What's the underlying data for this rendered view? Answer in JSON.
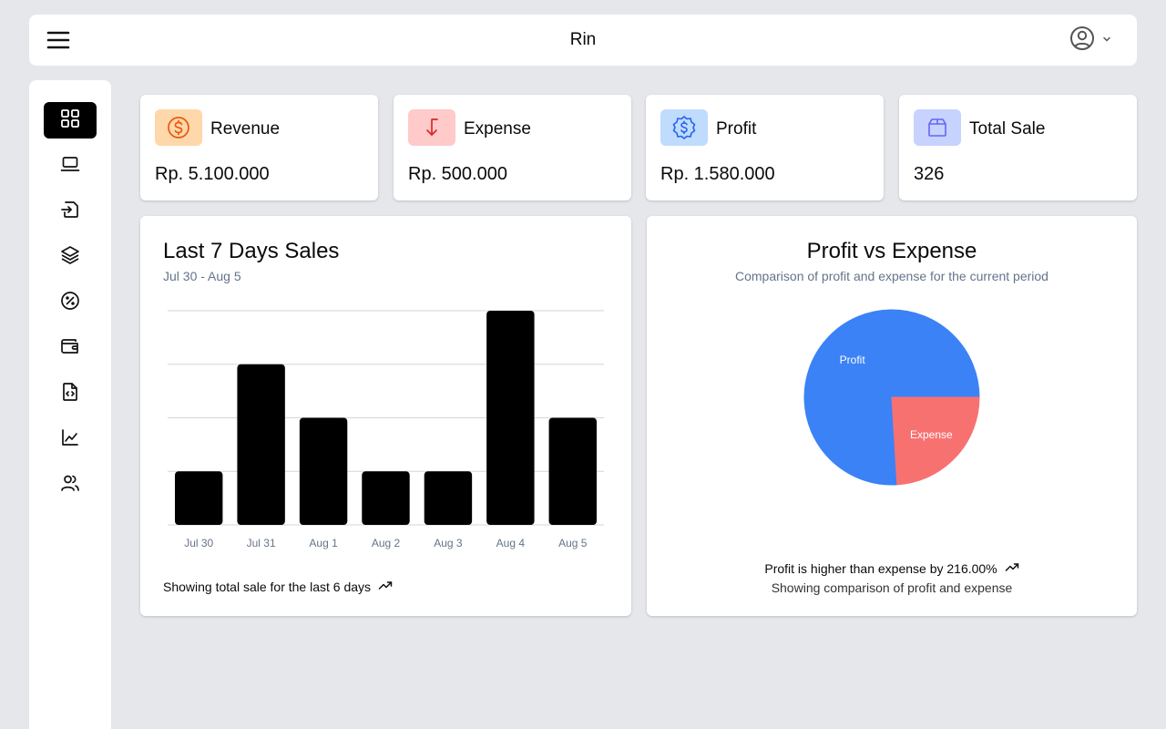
{
  "header": {
    "title": "Rin",
    "menu_icon": "hamburger-menu-icon",
    "user_icon": "user-circle-icon",
    "user_menu_icon": "chevron-down-icon"
  },
  "sidebar": {
    "items": [
      {
        "name": "dashboard",
        "icon": "grid-icon",
        "active": true
      },
      {
        "name": "products",
        "icon": "laptop-icon",
        "active": false
      },
      {
        "name": "transactions",
        "icon": "file-import-icon",
        "active": false
      },
      {
        "name": "categories",
        "icon": "layers-icon",
        "active": false
      },
      {
        "name": "discounts",
        "icon": "percent-badge-icon",
        "active": false
      },
      {
        "name": "wallet",
        "icon": "wallet-icon",
        "active": false
      },
      {
        "name": "reports",
        "icon": "file-code-icon",
        "active": false
      },
      {
        "name": "analytics",
        "icon": "line-chart-icon",
        "active": false
      },
      {
        "name": "users",
        "icon": "users-icon",
        "active": false
      }
    ]
  },
  "stats": [
    {
      "label": "Revenue",
      "value": "Rp. 5.100.000",
      "icon": "dollar-coin-icon",
      "bg": "#fed7aa",
      "fg": "#ea580c"
    },
    {
      "label": "Expense",
      "value": "Rp. 500.000",
      "icon": "arrow-down-left-icon",
      "bg": "#fecaca",
      "fg": "#dc2626"
    },
    {
      "label": "Profit",
      "value": "Rp. 1.580.000",
      "icon": "dollar-badge-icon",
      "bg": "#bfdbfe",
      "fg": "#2563eb"
    },
    {
      "label": "Total Sale",
      "value": "326",
      "icon": "box-icon",
      "bg": "#c7d2fe",
      "fg": "#6366f1"
    }
  ],
  "sales_card": {
    "title": "Last 7 Days Sales",
    "subtitle": "Jul 30 - Aug 5",
    "footer": "Showing total sale for the last 6 days",
    "footer_icon": "trending-up-icon"
  },
  "profit_card": {
    "title": "Profit vs Expense",
    "subtitle": "Comparison of profit and expense for the current period",
    "footer_main": "Profit is higher than expense by 216.00%",
    "footer_icon": "trending-up-icon",
    "footer_sub": "Showing comparison of profit and expense"
  },
  "colors": {
    "bar": "#000000",
    "profit": "#3b82f6",
    "expense": "#f87171",
    "grid": "#d1d5db"
  },
  "chart_data": [
    {
      "type": "bar",
      "categories": [
        "Jul 30",
        "Jul 31",
        "Aug 1",
        "Aug 2",
        "Aug 3",
        "Aug 4",
        "Aug 5"
      ],
      "values": [
        1,
        3,
        2,
        1,
        1,
        4,
        2
      ],
      "ylim": [
        0,
        4
      ],
      "grid": true,
      "legend": "none"
    },
    {
      "type": "pie",
      "slices": [
        {
          "label": "Profit",
          "value": 1580000
        },
        {
          "label": "Expense",
          "value": 500000
        }
      ],
      "legend": "none"
    }
  ]
}
